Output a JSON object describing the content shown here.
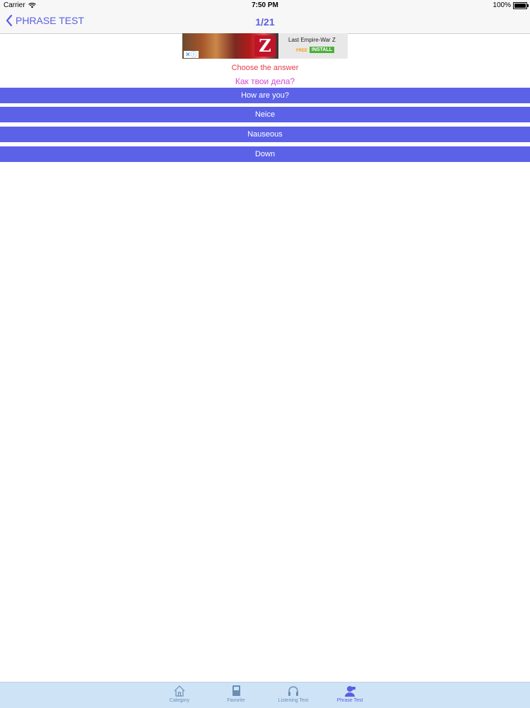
{
  "status_bar": {
    "carrier": "Carrier",
    "time": "7:50 PM",
    "battery": "100%"
  },
  "nav": {
    "back_label": "PHRASE TEST",
    "title": "1/21"
  },
  "ad": {
    "title": "Last Empire-War Z",
    "free_label": "FREE",
    "install_label": "INSTALL",
    "logo_letter": "Z"
  },
  "quiz": {
    "instruction": "Choose the answer",
    "question": "Как твои дела?",
    "answers": [
      "How are you?",
      "Neice",
      "Nauseous",
      "Down"
    ]
  },
  "tab_bar": {
    "items": [
      {
        "label": "Category",
        "icon": "home-icon"
      },
      {
        "label": "Favorite",
        "icon": "book-icon"
      },
      {
        "label": "Listening Test",
        "icon": "headphones-icon"
      },
      {
        "label": "Phrase Test",
        "icon": "person-icon"
      }
    ],
    "active_index": 3
  },
  "colors": {
    "accent": "#5a5fe0",
    "answer_bg": "#5b62e8",
    "instruction": "#e83a4a",
    "question": "#d347d3",
    "tab_bar_bg": "#cfe3f7"
  }
}
